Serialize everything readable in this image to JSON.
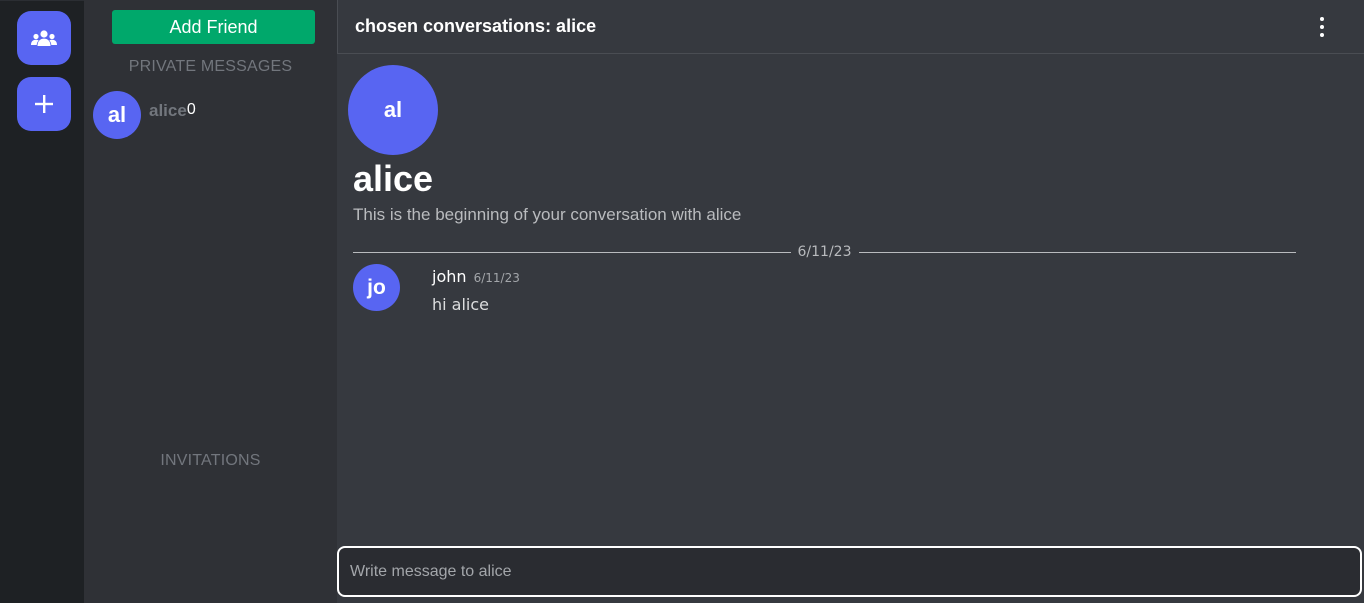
{
  "rail": {
    "friends_icon": "people-group-icon",
    "add_icon": "plus-icon"
  },
  "sidebar": {
    "add_friend_label": "Add Friend",
    "private_messages_title": "PRIVATE MESSAGES",
    "invitations_title": "INVITATIONS",
    "dms": [
      {
        "avatar_initials": "al",
        "name": "alice",
        "count": "0"
      }
    ]
  },
  "header": {
    "title": "chosen conversations: alice",
    "menu_icon": "kebab-menu-icon"
  },
  "conversation": {
    "avatar_initials": "al",
    "name": "alice",
    "intro": "This is the beginning of your conversation with alice",
    "date_divider": "6/11/23",
    "messages": [
      {
        "avatar_initials": "jo",
        "author": "john",
        "time": "6/11/23",
        "text": "hi alice"
      }
    ]
  },
  "composer": {
    "placeholder": "Write message to alice",
    "value": ""
  },
  "colors": {
    "accent": "#5865f2",
    "add_friend": "#00a86b",
    "rail_bg": "#1e2124",
    "sidebar_bg": "#2f3136",
    "main_bg": "#36393f"
  }
}
